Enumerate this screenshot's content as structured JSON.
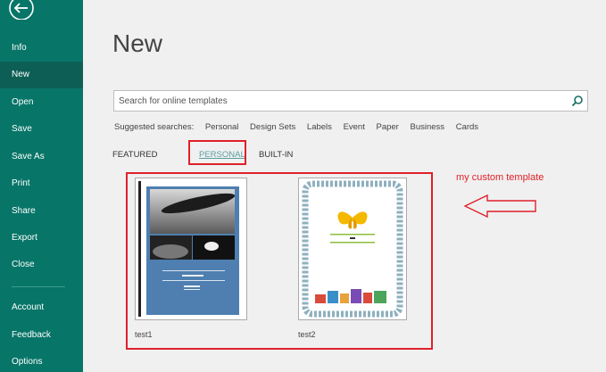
{
  "sidebar": {
    "items": [
      {
        "label": "Info"
      },
      {
        "label": "New"
      },
      {
        "label": "Open"
      },
      {
        "label": "Save"
      },
      {
        "label": "Save As"
      },
      {
        "label": "Print"
      },
      {
        "label": "Share"
      },
      {
        "label": "Export"
      },
      {
        "label": "Close"
      },
      {
        "label": "Account"
      },
      {
        "label": "Feedback"
      },
      {
        "label": "Options"
      }
    ],
    "active_item": "New",
    "back_icon": "back-arrow-icon"
  },
  "main": {
    "title": "New",
    "search": {
      "placeholder": "Search for online templates",
      "icon": "search-icon"
    },
    "suggested": {
      "label": "Suggested searches:",
      "links": [
        "Personal",
        "Design Sets",
        "Labels",
        "Event",
        "Paper",
        "Business",
        "Cards"
      ]
    },
    "tabs": [
      {
        "label": "FEATURED"
      },
      {
        "label": "PERSONAL"
      },
      {
        "label": "BUILT-IN"
      }
    ],
    "active_tab": "PERSONAL",
    "templates": [
      {
        "name": "test1"
      },
      {
        "name": "test2"
      }
    ]
  },
  "annotation": {
    "text": "my custom template",
    "color": "#e0202a"
  },
  "colors": {
    "sidebar": "#077568",
    "sidebar_active": "#0d5f55",
    "accent_red": "#e0202a",
    "personal_tab": "#5a9ea0"
  }
}
